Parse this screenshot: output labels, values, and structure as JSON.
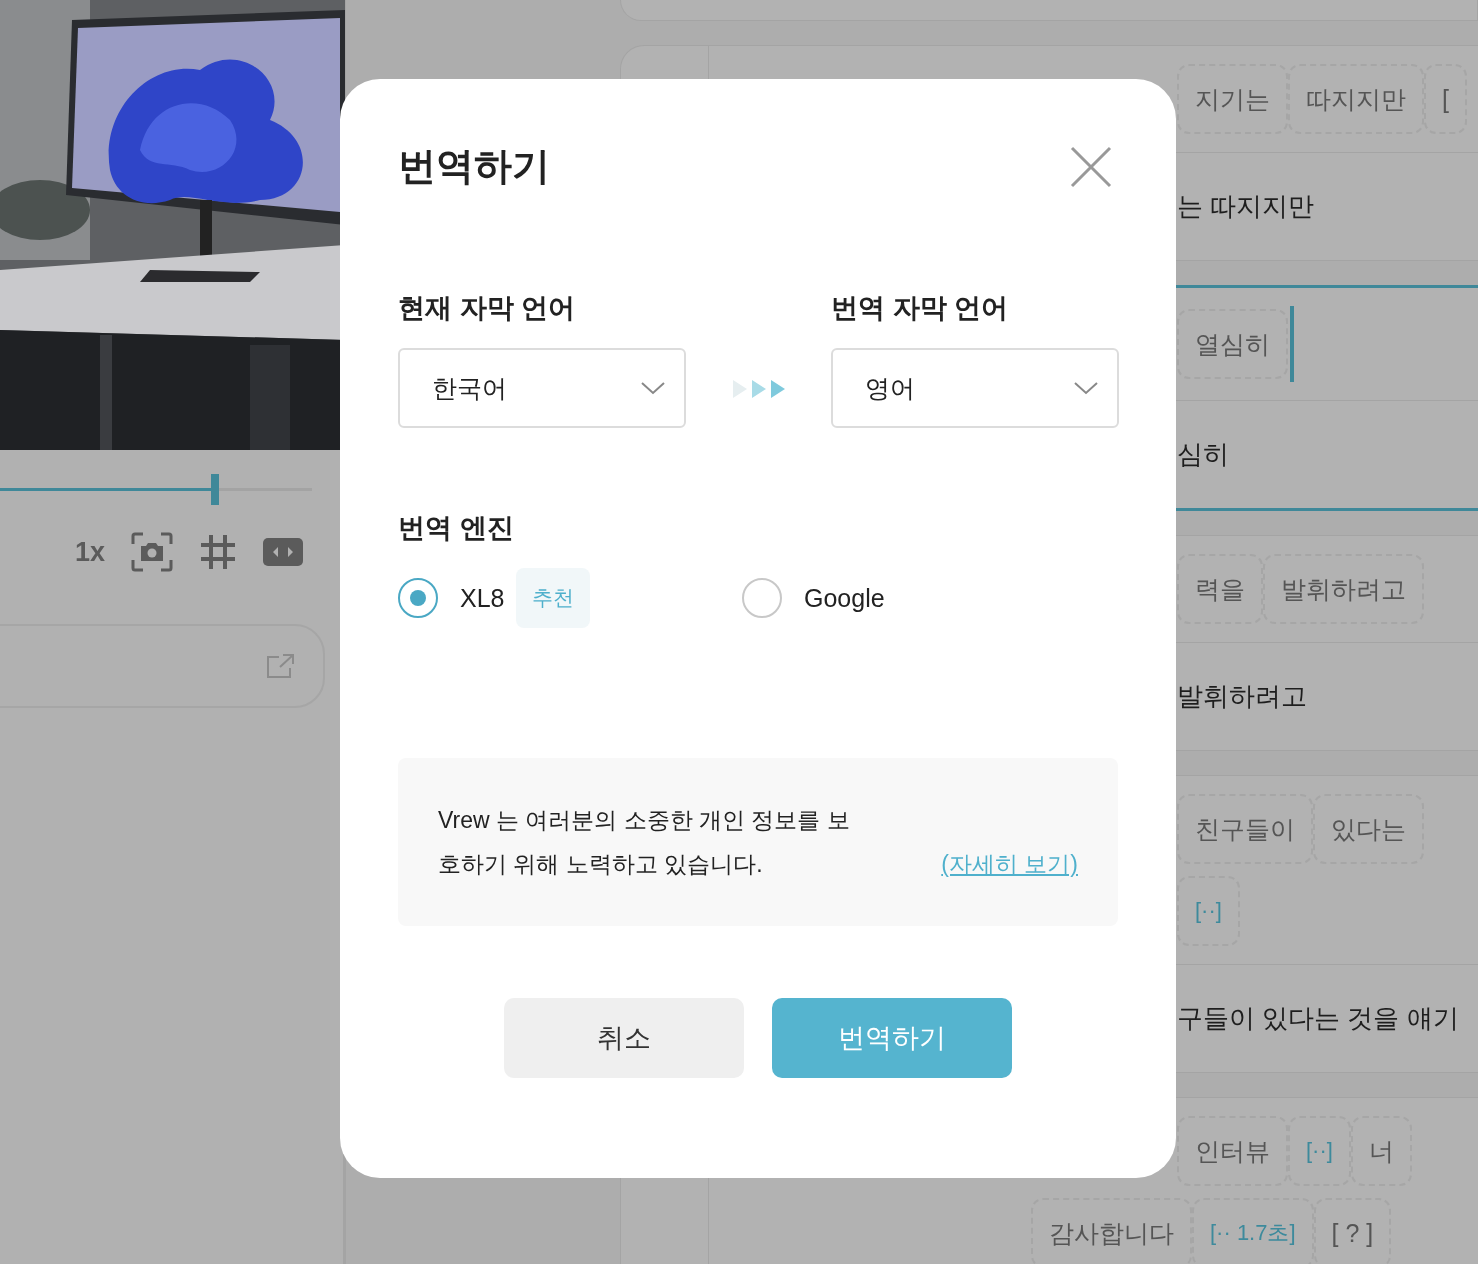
{
  "video_panel": {
    "seek": {
      "level": 0.69
    },
    "toolbar": {
      "speed": "1x"
    }
  },
  "clips": [
    {
      "selected": false,
      "lines": [
        {
          "words": [
            {
              "text": "지기는",
              "kind": "word"
            },
            {
              "text": "따지지만",
              "kind": "word"
            },
            {
              "text": "[",
              "kind": "word"
            }
          ]
        }
      ],
      "sentence": "는 따지지만"
    },
    {
      "selected": true,
      "lines": [
        {
          "words": [
            {
              "text": "열심히",
              "kind": "word"
            }
          ]
        }
      ],
      "sentence": "심히"
    },
    {
      "selected": false,
      "lines": [
        {
          "words": [
            {
              "text": "력을",
              "kind": "word"
            },
            {
              "text": "발휘하려고",
              "kind": "word"
            }
          ]
        }
      ],
      "sentence": "발휘하려고"
    },
    {
      "selected": false,
      "lines": [
        {
          "words": [
            {
              "text": "친구들이",
              "kind": "word"
            },
            {
              "text": "있다는",
              "kind": "word"
            }
          ]
        },
        {
          "words": [
            {
              "text": "[··]",
              "kind": "pause"
            }
          ]
        }
      ],
      "sentence": "구들이 있다는 것을 얘기"
    },
    {
      "selected": false,
      "lines": [
        {
          "words": [
            {
              "text": "인터뷰",
              "kind": "word"
            },
            {
              "text": "[··]",
              "kind": "pause"
            },
            {
              "text": "너",
              "kind": "word"
            }
          ]
        },
        {
          "words": [
            {
              "text": "감사합니다",
              "kind": "word"
            },
            {
              "text": "[·· 1.7초]",
              "kind": "pause"
            },
            {
              "text": "[ ? ]",
              "kind": "unknown"
            }
          ]
        }
      ]
    }
  ],
  "dialog": {
    "title": "번역하기",
    "source": {
      "label": "현재 자막 언어",
      "value": "한국어"
    },
    "target": {
      "label": "번역 자막 언어",
      "value": "영어"
    },
    "engine": {
      "label": "번역 엔진",
      "options": [
        {
          "name": "XL8",
          "badge": "추천",
          "selected": true
        },
        {
          "name": "Google",
          "selected": false
        }
      ]
    },
    "notice": {
      "text": "Vrew 는 여러분의 소중한 개인 정보를 보호하기 위해 노력하고 있습니다.",
      "link": "(자세히 보기)"
    },
    "buttons": [
      {
        "label": "취소",
        "kind": "secondary"
      },
      {
        "label": "번역하기",
        "kind": "primary"
      }
    ]
  }
}
